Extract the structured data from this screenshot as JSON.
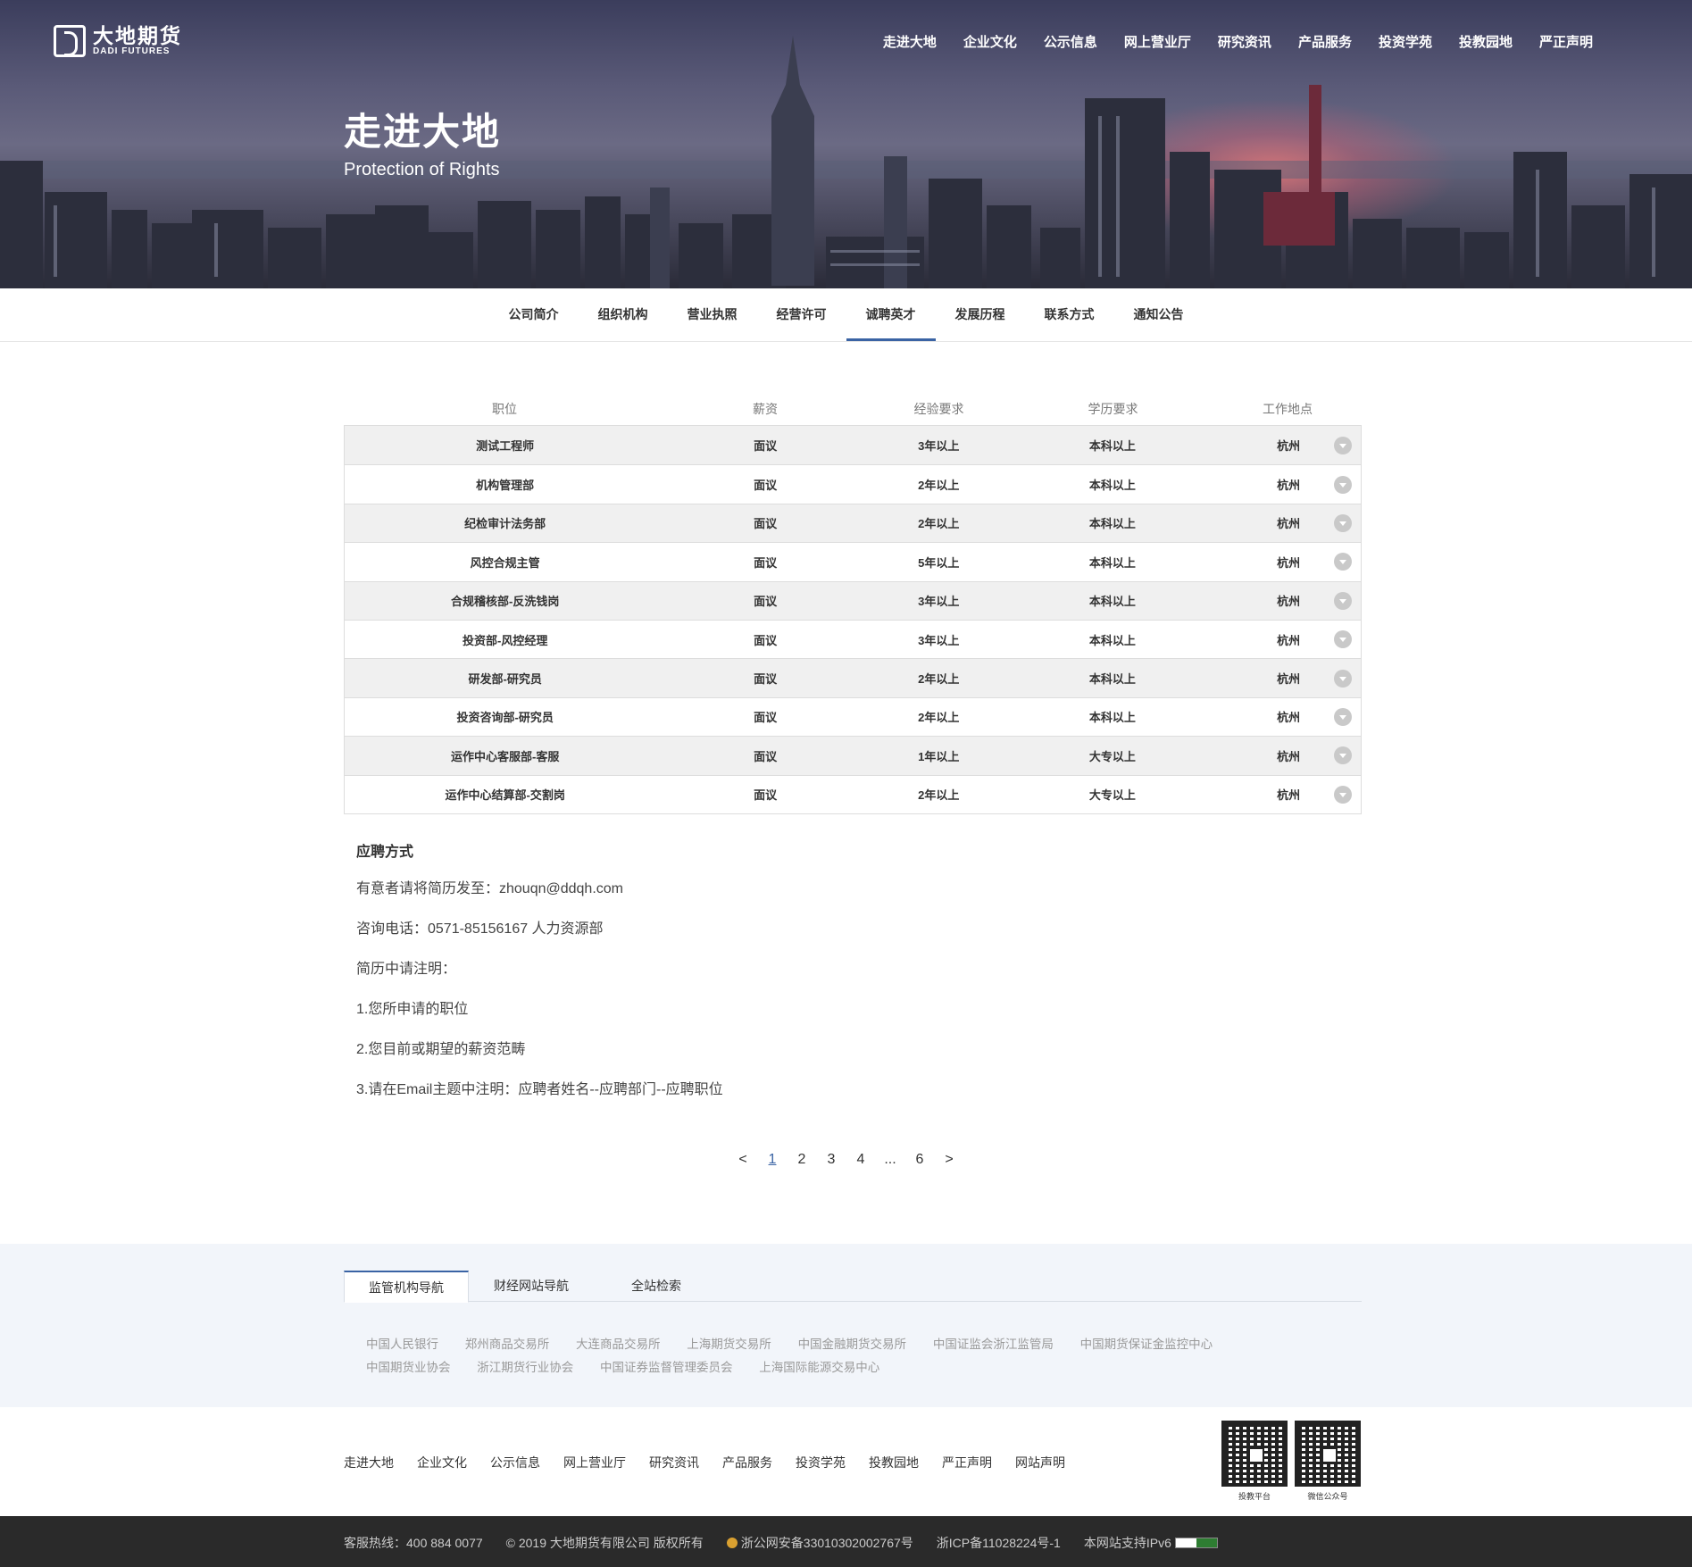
{
  "brand": {
    "name_cn": "大地期货",
    "name_en": "DADI FUTURES"
  },
  "topnav": [
    "走进大地",
    "企业文化",
    "公示信息",
    "网上营业厅",
    "研究资讯",
    "产品服务",
    "投资学苑",
    "投教园地",
    "严正声明"
  ],
  "hero": {
    "title": "走进大地",
    "subtitle": "Protection of Rights"
  },
  "subnav": {
    "items": [
      "公司简介",
      "组织机构",
      "营业执照",
      "经营许可",
      "诚聘英才",
      "发展历程",
      "联系方式",
      "通知公告"
    ],
    "active": "诚聘英才"
  },
  "jobs": {
    "headers": [
      "职位",
      "薪资",
      "经验要求",
      "学历要求",
      "工作地点"
    ],
    "rows": [
      [
        "测试工程师",
        "面议",
        "3年以上",
        "本科以上",
        "杭州"
      ],
      [
        "机构管理部",
        "面议",
        "2年以上",
        "本科以上",
        "杭州"
      ],
      [
        "纪检审计法务部",
        "面议",
        "2年以上",
        "本科以上",
        "杭州"
      ],
      [
        "风控合规主管",
        "面议",
        "5年以上",
        "本科以上",
        "杭州"
      ],
      [
        "合规稽核部-反洗钱岗",
        "面议",
        "3年以上",
        "本科以上",
        "杭州"
      ],
      [
        "投资部-风控经理",
        "面议",
        "3年以上",
        "本科以上",
        "杭州"
      ],
      [
        "研发部-研究员",
        "面议",
        "2年以上",
        "本科以上",
        "杭州"
      ],
      [
        "投资咨询部-研究员",
        "面议",
        "2年以上",
        "本科以上",
        "杭州"
      ],
      [
        "运作中心客服部-客服",
        "面议",
        "1年以上",
        "大专以上",
        "杭州"
      ],
      [
        "运作中心结算部-交割岗",
        "面议",
        "2年以上",
        "大专以上",
        "杭州"
      ]
    ]
  },
  "apply": {
    "title": "应聘方式",
    "lines": [
      "有意者请将简历发至：zhouqn@ddqh.com",
      "咨询电话：0571-85156167 人力资源部",
      "简历中请注明：",
      "1.您所申请的职位",
      "2.您目前或期望的薪资范畴",
      "3.请在Email主题中注明：应聘者姓名--应聘部门--应聘职位"
    ]
  },
  "pager": {
    "prev": "<",
    "pages": [
      "1",
      "2",
      "3",
      "4",
      "...",
      "6"
    ],
    "current": "1",
    "next": ">"
  },
  "footer_links": {
    "tabs": [
      "监管机构导航",
      "财经网站导航",
      "全站检索"
    ],
    "active_tab": "监管机构导航",
    "links": [
      "中国人民银行",
      "郑州商品交易所",
      "大连商品交易所",
      "上海期货交易所",
      "中国金融期货交易所",
      "中国证监会浙江监管局",
      "中国期货保证金监控中心",
      "中国期货业协会",
      "浙江期货行业协会",
      "中国证券监督管理委员会",
      "上海国际能源交易中心"
    ]
  },
  "footer_nav": [
    "走进大地",
    "企业文化",
    "公示信息",
    "网上营业厅",
    "研究资讯",
    "产品服务",
    "投资学苑",
    "投教园地",
    "严正声明",
    "网站声明"
  ],
  "qrcodes": [
    {
      "label": "投教平台"
    },
    {
      "label": "微信公众号"
    }
  ],
  "bottom_bar": {
    "hotline": "客服热线：400 884 0077",
    "copyright": "© 2019 大地期货有限公司 版权所有",
    "police": "浙公网安备33010302002767号",
    "icp": "浙ICP备11028224号-1",
    "ipv6": "本网站支持IPv6"
  },
  "colors": {
    "accent": "#3a63a4",
    "row_alt": "#f0f0f0",
    "footer_bg": "#f2f5fa",
    "bottom_bar": "#2a2a2a"
  }
}
